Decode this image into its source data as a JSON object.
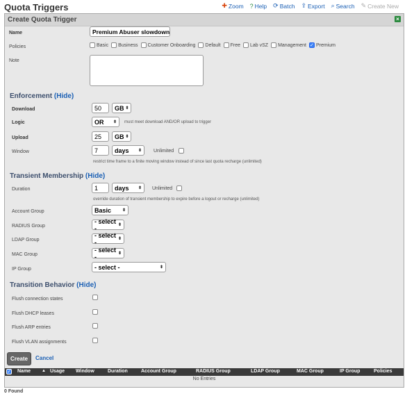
{
  "page": {
    "title": "Quota Triggers",
    "found": "0 Found"
  },
  "toolbar": [
    {
      "icon": "zoom-icon",
      "glyph": "✚",
      "color": "#d9480f",
      "label": "Zoom"
    },
    {
      "icon": "help-icon",
      "glyph": "?",
      "color": "#2b8a3e",
      "label": "Help"
    },
    {
      "icon": "batch-icon",
      "glyph": "⟳",
      "color": "#1a5fb4",
      "label": "Batch"
    },
    {
      "icon": "export-icon",
      "glyph": "⇪",
      "color": "#1a5fb4",
      "label": "Export"
    },
    {
      "icon": "search-icon",
      "glyph": "⌕",
      "color": "#1a5fb4",
      "label": "Search"
    },
    {
      "icon": "create-new-icon",
      "glyph": "✎",
      "color": "#aaa",
      "label": "Create New"
    }
  ],
  "form": {
    "title": "Create Quota Trigger",
    "name_label": "Name",
    "name_value": "Premium Abuser slowdown",
    "policies_label": "Policies",
    "policies": [
      {
        "label": "Basic",
        "checked": false
      },
      {
        "label": "Business",
        "checked": false
      },
      {
        "label": "Customer Onboarding",
        "checked": false
      },
      {
        "label": "Default",
        "checked": false
      },
      {
        "label": "Free",
        "checked": false
      },
      {
        "label": "Lab vSZ",
        "checked": false
      },
      {
        "label": "Management",
        "checked": false
      },
      {
        "label": "Premium",
        "checked": true
      }
    ],
    "note_label": "Note",
    "note_value": ""
  },
  "enforcement": {
    "title": "Enforcement",
    "hide": "(Hide)",
    "download_label": "Download",
    "download_value": "50",
    "download_unit": "GB",
    "logic_label": "Logic",
    "logic_value": "OR",
    "logic_hint": "must meet download AND/OR upload to trigger",
    "upload_label": "Upload",
    "upload_value": "25",
    "upload_unit": "GB",
    "window_label": "Window",
    "window_value": "7",
    "window_unit": "days",
    "unlimited_label": "Unlimited",
    "window_hint": "restrict time frame to a finite moving window instead of since last quota recharge (unlimited)"
  },
  "transient": {
    "title": "Transient Membership",
    "hide": "(Hide)",
    "duration_label": "Duration",
    "duration_value": "1",
    "duration_unit": "days",
    "unlimited_label": "Unlimited",
    "duration_hint": "override duration of transient membership to expire before a logout or recharge (unlimited)",
    "account_group_label": "Account Group",
    "account_group_value": "Basic",
    "radius_group_label": "RADIUS Group",
    "radius_group_value": "- select -",
    "ldap_group_label": "LDAP Group",
    "ldap_group_value": "- select -",
    "mac_group_label": "MAC Group",
    "mac_group_value": "- select -",
    "ip_group_label": "IP Group",
    "ip_group_value": "- select -"
  },
  "transition": {
    "title": "Transition Behavior",
    "hide": "(Hide)",
    "items": [
      {
        "label": "Flush connection states"
      },
      {
        "label": "Flush DHCP leases"
      },
      {
        "label": "Flush ARP entries"
      },
      {
        "label": "Flush VLAN assignments"
      }
    ]
  },
  "actions": {
    "create": "Create",
    "cancel": "Cancel"
  },
  "table": {
    "columns": [
      "Name",
      "Usage",
      "Window",
      "Duration",
      "Account Group",
      "RADIUS Group",
      "LDAP Group",
      "MAC Group",
      "IP Group",
      "Policies"
    ],
    "empty": "No Entries"
  }
}
